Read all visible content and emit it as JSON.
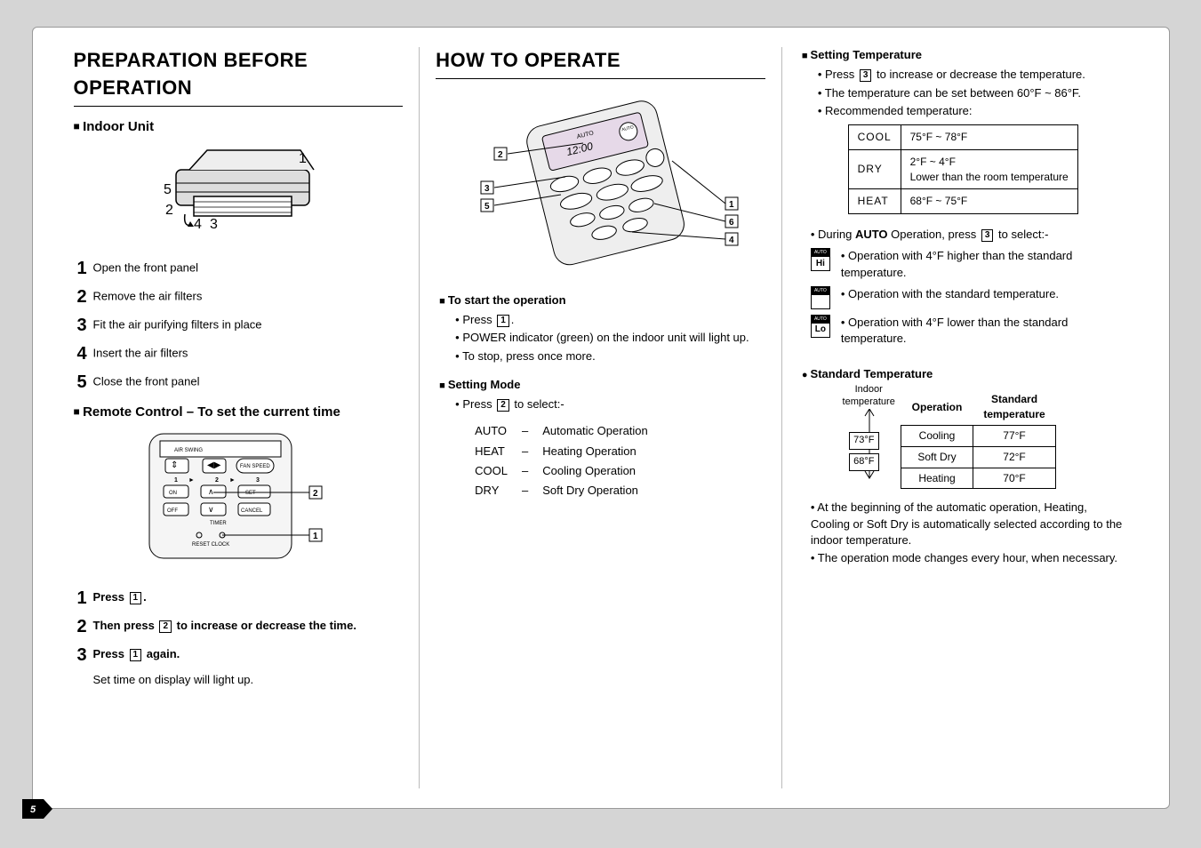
{
  "col1": {
    "title": "PREPARATION BEFORE OPERATION",
    "indoor_heading": "Indoor Unit",
    "indoor_steps": [
      "Open the front panel",
      "Remove the air filters",
      "Fit the air purifying filters in place",
      "Insert the air filters",
      "Close the front panel"
    ],
    "remote_heading": "Remote Control – To set the current time",
    "remote_labels": {
      "air_swing": "AIR SWING",
      "fan_speed": "FAN SPEED",
      "on": "ON",
      "off": "OFF",
      "set": "SET",
      "cancel": "CANCEL",
      "timer": "TIMER",
      "reset_clock": "RESET CLOCK",
      "n1": "1",
      "n2": "2",
      "n3": "3"
    },
    "remote_steps": [
      "Press  1 .",
      "Then press  2  to increase or decrease the time.",
      "Press  1  again."
    ],
    "remote_note": "Set time on display will light up."
  },
  "col2": {
    "title": "HOW TO OPERATE",
    "start_heading": "To start the operation",
    "start_bullets": [
      "Press  1 .",
      "POWER indicator (green) on the indoor unit will light up.",
      "To stop, press once more."
    ],
    "mode_heading": "Setting Mode",
    "mode_press": "Press  2  to select:-",
    "modes": [
      [
        "AUTO",
        "Automatic Operation"
      ],
      [
        "HEAT",
        "Heating Operation"
      ],
      [
        "COOL",
        "Cooling Operation"
      ],
      [
        "DRY",
        "Soft Dry Operation"
      ]
    ],
    "callouts": [
      "1",
      "2",
      "3",
      "4",
      "5",
      "6"
    ],
    "remote_display": {
      "auto": "AUTO",
      "time": "12:00",
      "auto2": "AUTO"
    }
  },
  "col3": {
    "temp_heading": "Setting Temperature",
    "temp_bullets": [
      "Press  3  to increase or decrease the temperature.",
      "The temperature can be set between 60°F ~ 86°F.",
      "Recommended temperature:"
    ],
    "rec_table": [
      [
        "COOL",
        "75°F ~ 78°F"
      ],
      [
        "DRY",
        "2°F ~ 4°F\nLower than the room temperature"
      ],
      [
        "HEAT",
        "68°F ~ 75°F"
      ]
    ],
    "auto_line_prefix": "During ",
    "auto_line_bold": "AUTO",
    "auto_line_suffix": " Operation, press  3  to select:-",
    "auto_options": [
      {
        "icon": "Hi",
        "text": "Operation with 4°F higher than the standard temperature."
      },
      {
        "icon": "",
        "text": "Operation with the standard temperature."
      },
      {
        "icon": "Lo",
        "text": "Operation with 4°F lower than the standard temperature."
      }
    ],
    "auto_icon_top": "AUTO",
    "std_heading": "Standard Temperature",
    "std_headers": {
      "indoor": "Indoor\ntemperature",
      "op": "Operation",
      "std": "Standard\ntemperature"
    },
    "std_rows": [
      [
        "Cooling",
        "77°F"
      ],
      [
        "Soft Dry",
        "72°F"
      ],
      [
        "Heating",
        "70°F"
      ]
    ],
    "std_boxes": [
      "73°F",
      "68°F"
    ],
    "std_bullets": [
      "At the beginning of the automatic operation, Heating, Cooling or Soft Dry is automatically selected according to the indoor temperature.",
      "The operation mode changes every hour, when necessary."
    ]
  },
  "page_number": "5"
}
